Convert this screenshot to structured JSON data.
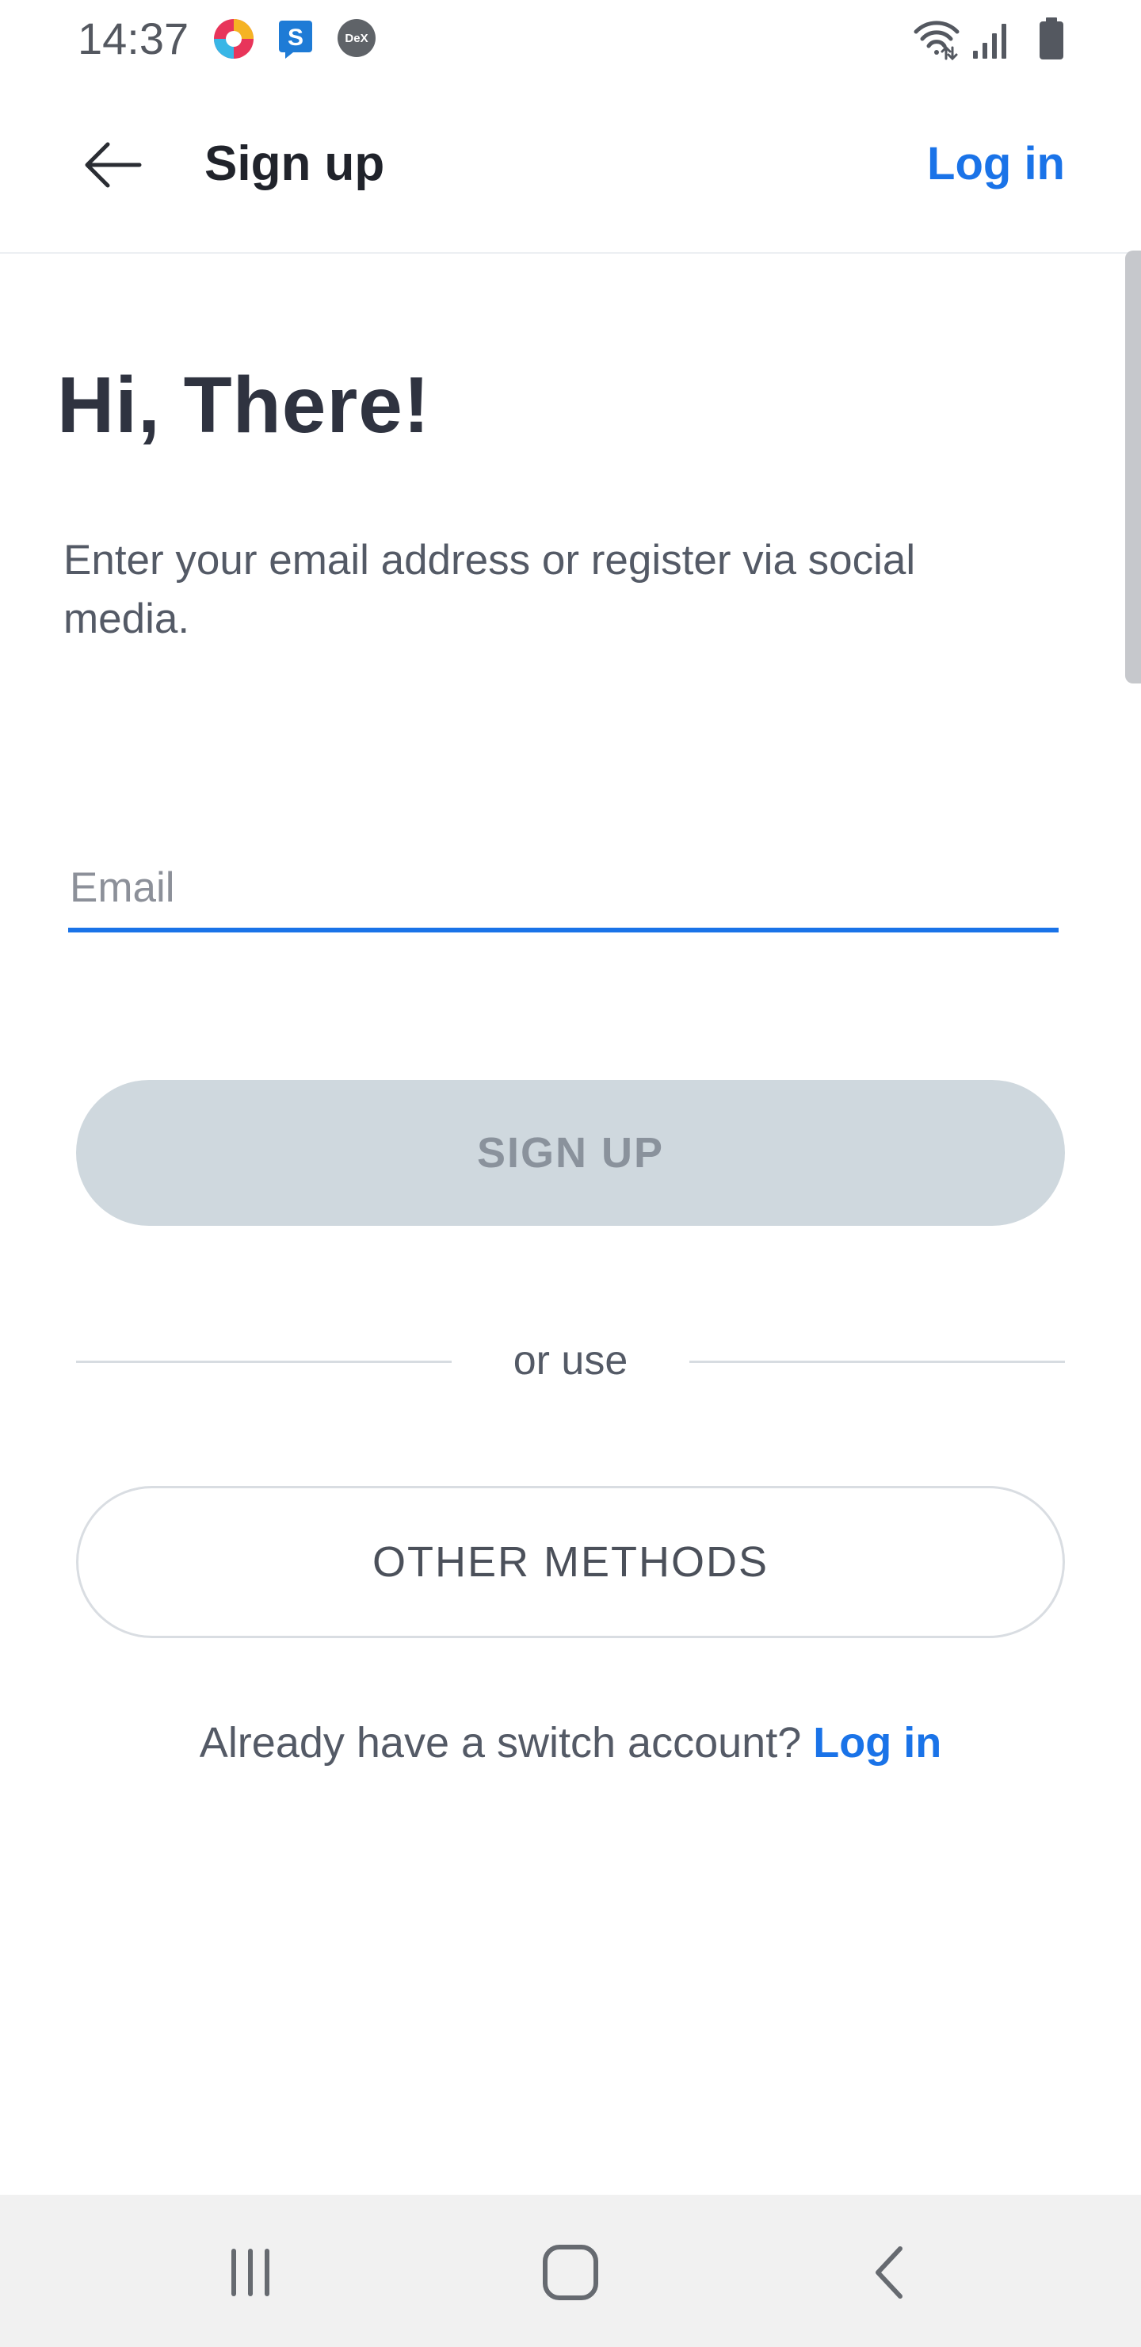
{
  "status_bar": {
    "time": "14:37",
    "app_icons": [
      "chrome-like-icon",
      "s-app-icon",
      "dex-icon"
    ],
    "dex_label": "DeX",
    "system_icons": [
      "wifi-icon",
      "signal-icon",
      "battery-icon"
    ]
  },
  "app_bar": {
    "back_icon": "arrow-left-icon",
    "title": "Sign up",
    "login_link": "Log in"
  },
  "main": {
    "heading": "Hi, There!",
    "subtitle": "Enter your email address or register via social media.",
    "email": {
      "placeholder": "Email",
      "value": ""
    },
    "signup_button": "SIGN UP",
    "divider_text": "or use",
    "other_methods_button": "OTHER METHODS",
    "login_prompt": "Already have a switch account?",
    "login_prompt_link": "Log in"
  },
  "nav_bar": {
    "items": [
      "recents-icon",
      "home-icon",
      "back-icon"
    ]
  },
  "colors": {
    "accent": "#1a73e8",
    "heading": "#2f3340",
    "disabled_button": "#cfd8de",
    "disabled_text": "#8a929c"
  }
}
